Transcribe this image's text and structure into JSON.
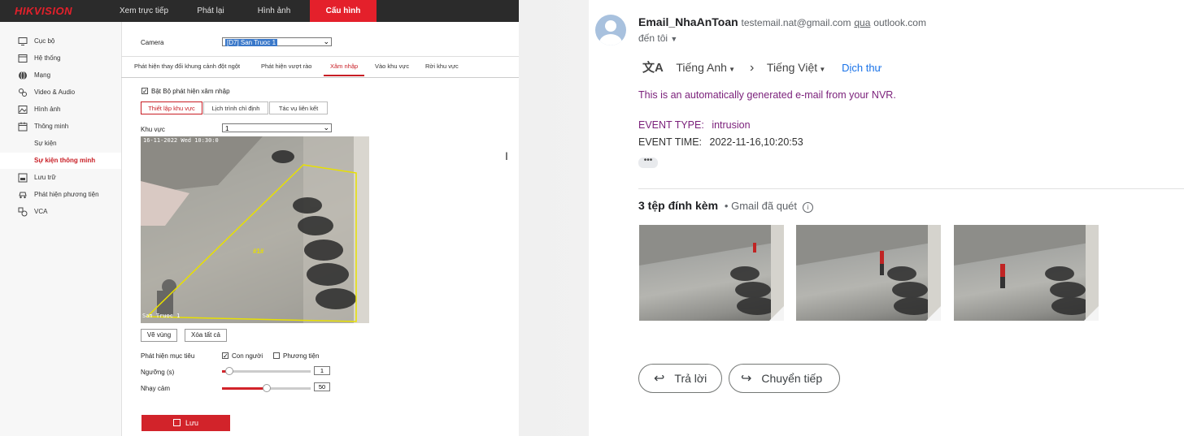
{
  "hikvision": {
    "logo": "HIKVISION",
    "top_nav": [
      "Xem trực tiếp",
      "Phát lại",
      "Hình ảnh",
      "Cấu hình"
    ],
    "sidebar": [
      {
        "label": "Cục bộ",
        "icon": "monitor-icon"
      },
      {
        "label": "Hệ thống",
        "icon": "system-icon"
      },
      {
        "label": "Mạng",
        "icon": "globe-icon"
      },
      {
        "label": "Video & Audio",
        "icon": "video-audio-icon"
      },
      {
        "label": "Hình ảnh",
        "icon": "image-icon"
      },
      {
        "label": "Thông minh",
        "icon": "calendar-icon"
      },
      {
        "label": "Sự kiện",
        "icon": ""
      },
      {
        "label": "Sự kiện thông minh",
        "icon": ""
      },
      {
        "label": "Lưu trữ",
        "icon": "storage-icon"
      },
      {
        "label": "Phát hiện phương tiện",
        "icon": "car-icon"
      },
      {
        "label": "VCA",
        "icon": "vca-icon"
      }
    ],
    "camera_label": "Camera",
    "camera_value": "[D7] San Truoc 1",
    "tabs": [
      "Phát hiện thay đổi khung cảnh đột ngột",
      "Phát hiện vượt rào",
      "Xâm nhập",
      "Vào khu vực",
      "Rời khu vực"
    ],
    "enable_label": "Bật Bộ phát hiện xâm nhập",
    "subtabs": [
      "Thiết lập khu vực",
      "Lịch trình chỉ định",
      "Tác vụ liên kết"
    ],
    "area_label": "Khu vực",
    "area_value": "1",
    "video_timestamp": "16-11-2022 Wed 10:30:0",
    "video_camera_name": "San Truoc 1",
    "region_label": "#1#",
    "draw_button": "Vẽ vùng",
    "clear_button": "Xóa tất cả",
    "target_label": "Phát hiện mục tiêu",
    "target_human": "Con người",
    "target_vehicle": "Phương tiện",
    "threshold_label": "Ngưỡng (s)",
    "threshold_value": "1",
    "threshold_fraction": 0.08,
    "sensitivity_label": "Nhạy cảm",
    "sensitivity_value": "50",
    "sensitivity_fraction": 0.5,
    "save_button": "Lưu",
    "accent": "#d2232a"
  },
  "gmail": {
    "sender_name": "Email_NhaAnToan",
    "sender_email": "testemail.nat@gmail.com",
    "via": "qua",
    "via_domain": "outlook.com",
    "to": "đến tôi",
    "from_lang": "Tiếng Anh",
    "to_lang": "Tiếng Việt",
    "translate_link": "Dịch thư",
    "body_line1": "This is an automatically generated e-mail from your NVR.",
    "event_type_label": "EVENT TYPE:",
    "event_type_value": "intrusion",
    "event_time_label": "EVENT TIME:",
    "event_time_value": "2022-11-16,10:20:53",
    "ellipsis": "•••",
    "attachments_title": "3 tệp đính kèm",
    "scanned": "• Gmail đã quét",
    "reply": "Trả lời",
    "forward": "Chuyển tiếp"
  }
}
